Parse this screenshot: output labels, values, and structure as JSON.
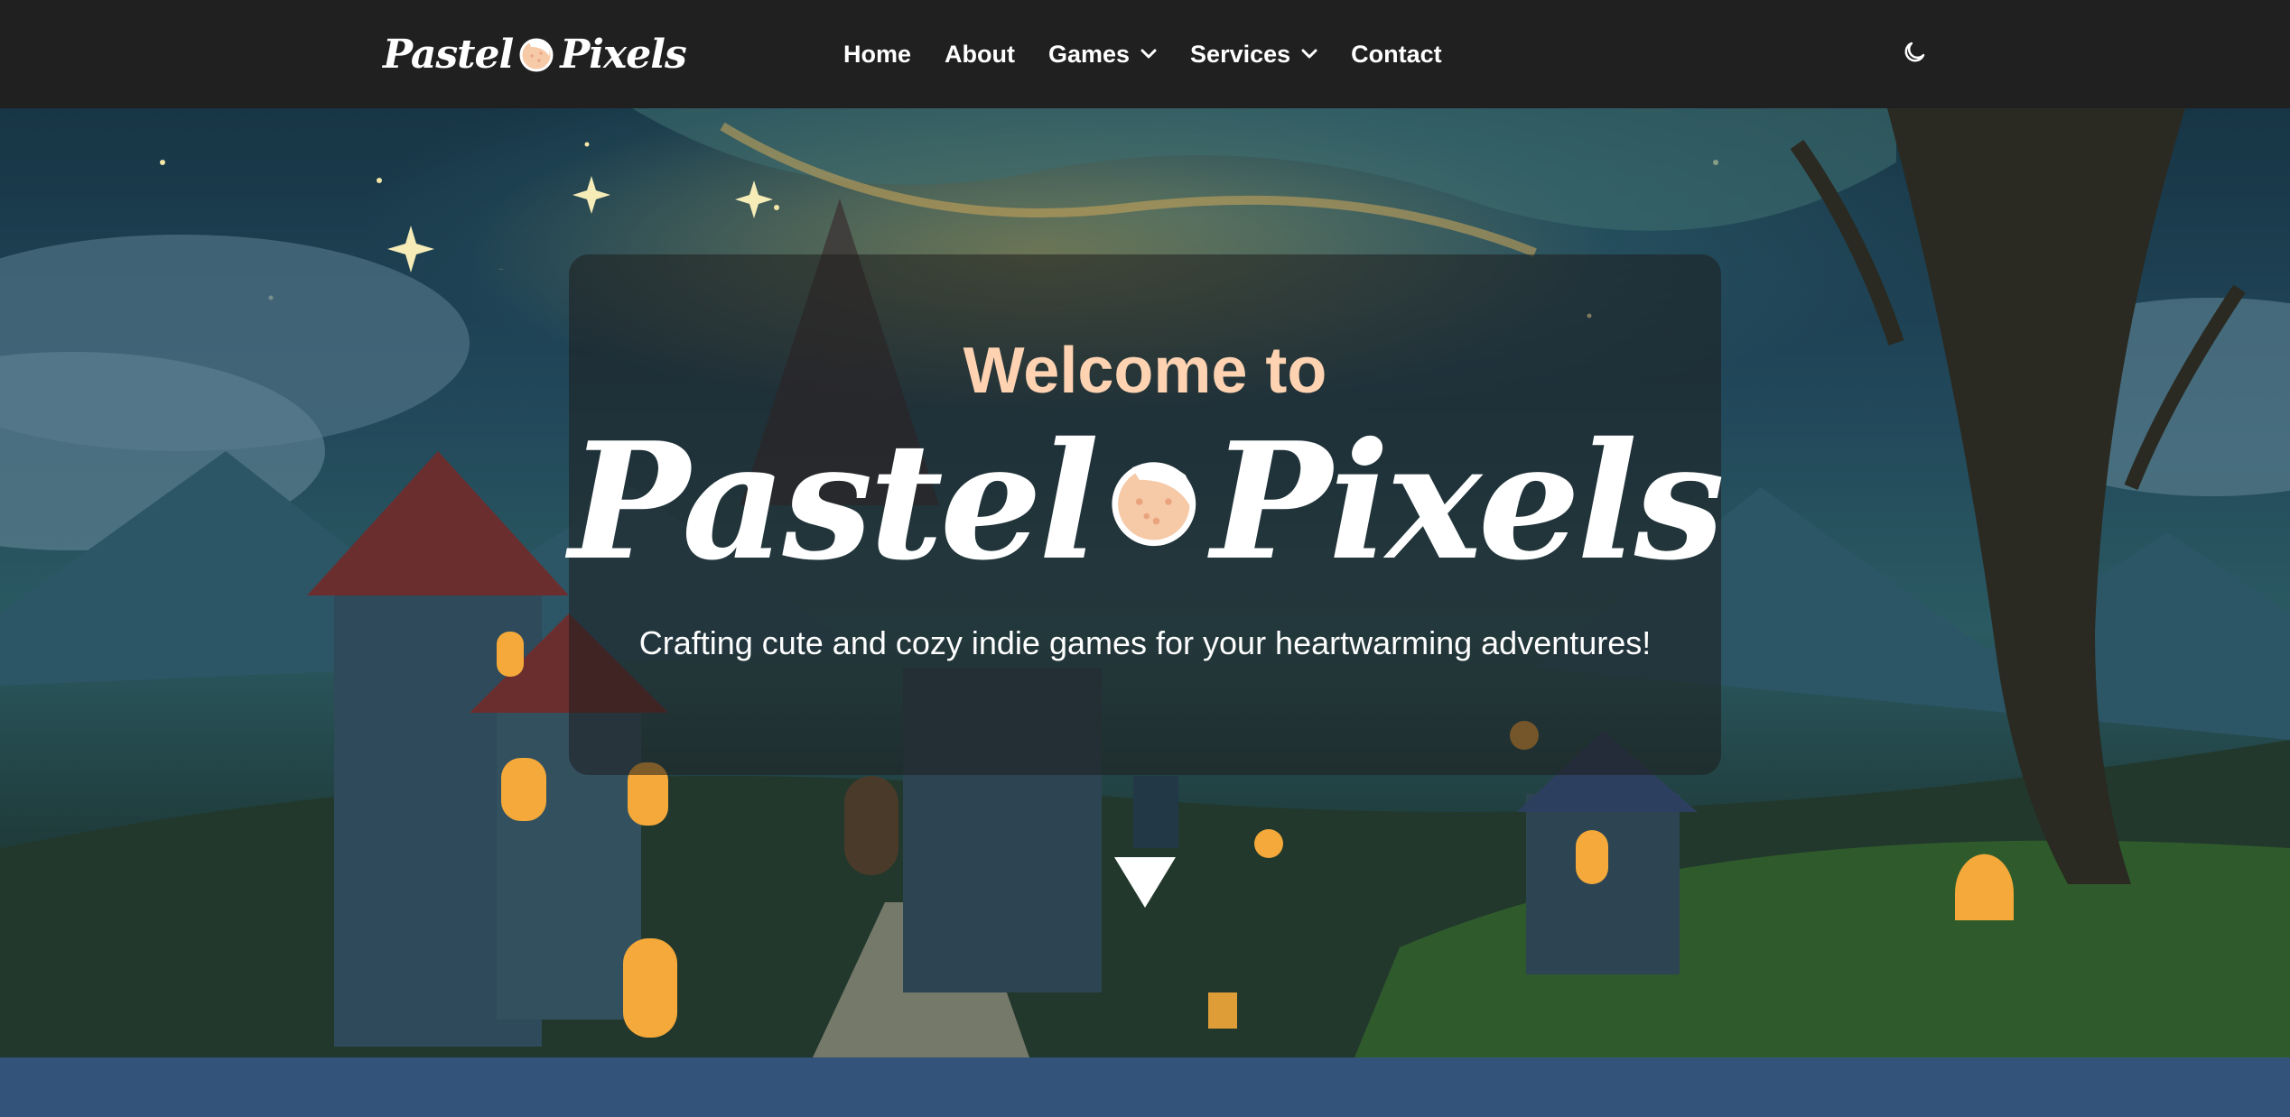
{
  "header": {
    "brand_left": "Pastel",
    "brand_right": "Pixels",
    "nav": [
      {
        "label": "Home"
      },
      {
        "label": "About"
      },
      {
        "label": "Games"
      },
      {
        "label": "Services"
      },
      {
        "label": "Contact"
      }
    ],
    "theme_toggle_icon": "moon-icon"
  },
  "hero": {
    "welcome": "Welcome to",
    "brand_left": "Pastel",
    "brand_right": "Pixels",
    "tagline": "Crafting cute and cozy indie games for your heartwarming adventures!",
    "scroll_icon": "triangle-down-icon"
  },
  "colors": {
    "header_bg": "#202020",
    "accent_peach": "#ffd3b2",
    "bottom_band": "#33537a"
  }
}
